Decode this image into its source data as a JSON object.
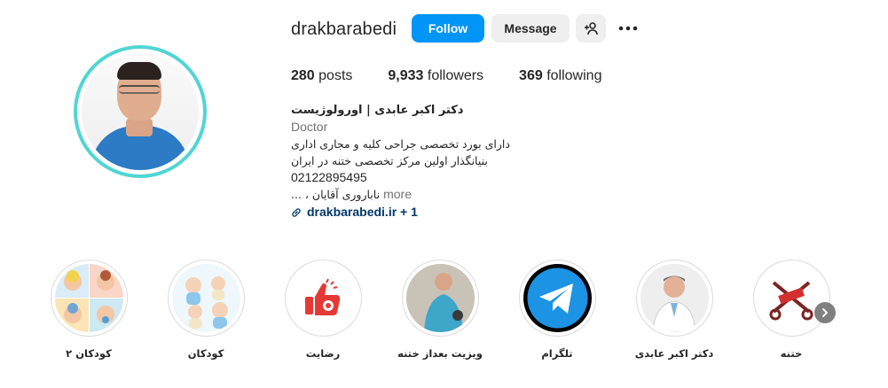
{
  "profile": {
    "username": "drakbarabedi",
    "follow_label": "Follow",
    "message_label": "Message",
    "stats": {
      "posts_count": "280",
      "posts_label": "posts",
      "followers_count": "9,933",
      "followers_label": "followers",
      "following_count": "369",
      "following_label": "following"
    },
    "bio": {
      "name": "دکتر اکبر عابدی | اورولوژیست",
      "category": "Doctor",
      "line1": "دارای بورد تخصصی جراحی کلیه و مجاری اداری",
      "line2": "بنیانگذار اولین مرکز تخصصی ختنه در ایران",
      "phone": "02122895495",
      "line3": "ناباروری آقایان ، ...",
      "more_label": "more",
      "link_text": "drakbarabedi.ir",
      "link_extra": "+ 1"
    },
    "colors": {
      "follow_button": "#0095f6",
      "avatar_ring": "#4fd6d3",
      "link": "#00376b"
    }
  },
  "highlights": [
    {
      "label": "کودکان ۲",
      "icon": "babies-collage"
    },
    {
      "label": "کودکان",
      "icon": "babies-illustration"
    },
    {
      "label": "رضایت",
      "icon": "thumbs-up"
    },
    {
      "label": "ویزیت بعداز ختنه",
      "icon": "doctor-visit-photo"
    },
    {
      "label": "تلگرام",
      "icon": "telegram-icon"
    },
    {
      "label": "دکتر اکبر عابدی",
      "icon": "doctor-portrait"
    },
    {
      "label": "ختنه",
      "icon": "scissors-illustration"
    }
  ]
}
